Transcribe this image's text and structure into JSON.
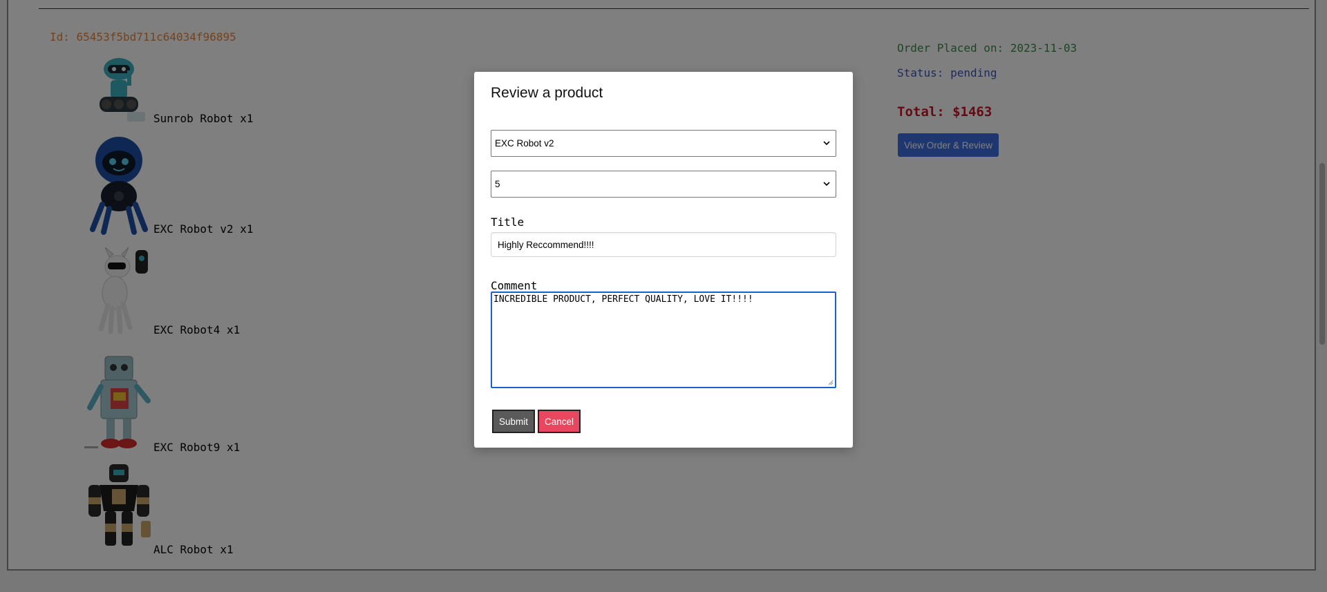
{
  "order": {
    "id_text": "Id: 65453f5bd711c64034f96895",
    "placed_text": "Order Placed on: 2023-11-03",
    "status_text": "Status: pending",
    "total_text": "Total: $1463",
    "view_button_label": "View Order & Review",
    "items": [
      {
        "label": "Sunrob Robot x1",
        "image": "teal-wheeled-robot"
      },
      {
        "label": "EXC Robot v2 x1",
        "image": "blue-dome-robot"
      },
      {
        "label": "EXC Robot4 x1",
        "image": "white-robot-dog"
      },
      {
        "label": "EXC Robot9 x1",
        "image": "tin-toy-robot"
      },
      {
        "label": "ALC Robot x1",
        "image": "black-gold-robot"
      }
    ]
  },
  "modal": {
    "title": "Review a product",
    "product_select_value": "EXC Robot v2",
    "rating_select_value": "5",
    "title_label": "Title",
    "title_value": "Highly Reccommend!!!!",
    "comment_label": "Comment",
    "comment_value": "INCREDIBLE PRODUCT, PERFECT QUALITY, LOVE IT!!!!",
    "submit_label": "Submit",
    "cancel_label": "Cancel"
  },
  "colors": {
    "order_id": "#e8873a",
    "placed": "#3a8a4a",
    "status": "#3c55b8",
    "total": "#cf1026",
    "view_button": "#3f6fe0",
    "cancel_button": "#e8475f",
    "submit_button": "#5a5a5a"
  }
}
